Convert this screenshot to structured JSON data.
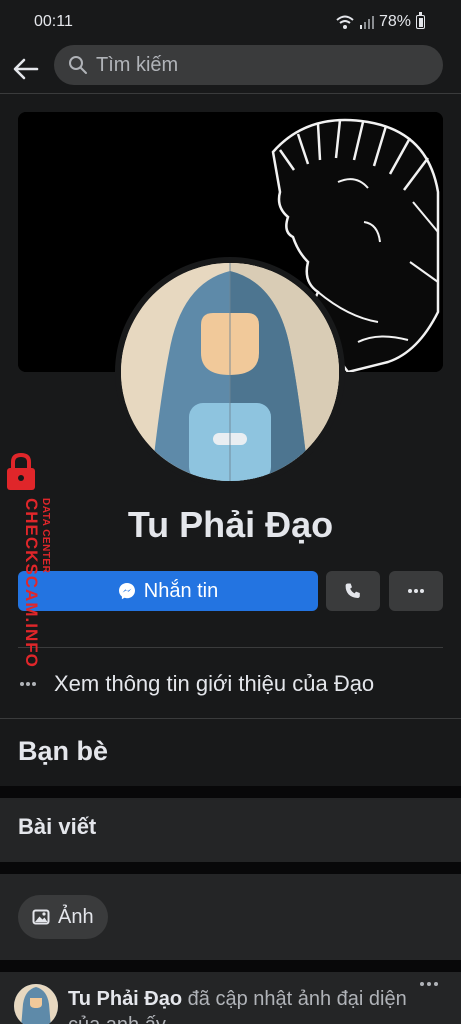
{
  "status_bar": {
    "time": "00:11",
    "battery": "78%"
  },
  "search": {
    "placeholder": "Tìm kiếm"
  },
  "profile": {
    "name": "Tu Phải Đạo"
  },
  "actions": {
    "message_label": "Nhắn tin"
  },
  "about": {
    "text": "Xem thông tin giới thiệu của Đạo"
  },
  "sections": {
    "friends": "Bạn bè",
    "posts": "Bài viết"
  },
  "filters": {
    "photos": "Ảnh"
  },
  "post": {
    "author": "Tu Phải Đạo",
    "text": " đã cập nhật ảnh đại diện của anh ấy."
  },
  "watermark": {
    "line1": "DATA CENTER",
    "line2": "CHECKSCAM.INFO"
  },
  "colors": {
    "background": "#18191a",
    "card": "#242526",
    "accent": "#2374e1",
    "watermark": "#e0262a"
  }
}
